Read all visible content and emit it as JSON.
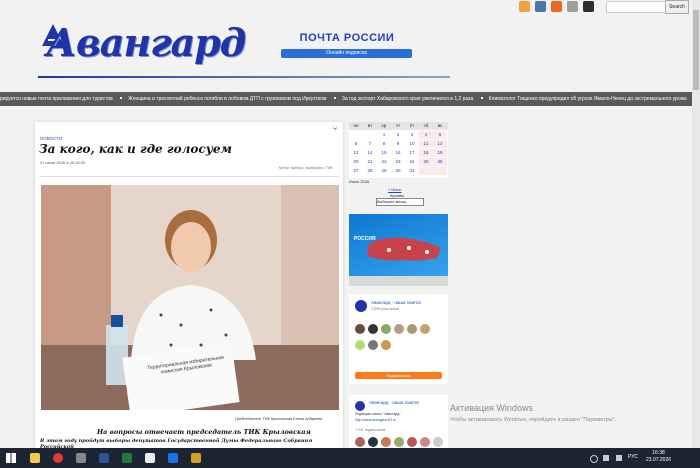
{
  "header": {
    "logo_text": "Авангард",
    "post_title": "ПОЧТА РОССИИ",
    "post_button": "Онлайн подписка",
    "search_button": "Search"
  },
  "ticker": [
    "рируется новые почта приложения для туристов",
    "Женщина и трехлетний ребенок погибли в лобовом ДТП с грузовиком под Иркутском",
    "За год экспорт Хабаровского края увеличился в 1,2 раза",
    "Климатолог Тищенко предупредил об угрозе Ямало-Ненец до экстремального урожа"
  ],
  "article": {
    "rubric": "НОВОСТИ",
    "title": "За кого, как и где голосуем",
    "date": "21 июля 2026 в 20:18:33",
    "tags": "Метки: выборы | выбираем | ТИК",
    "photo_sign": "Территориальная избирательная комиссия Крыловская",
    "caption": "Председатель ТИК Крыловская Елена Андреева",
    "lead": "На вопросы отвечает председатель ТИК Крыловская",
    "body_line": "В этом году пройдут выборы депутатов Государственной Думы Федерального Собрания Российской"
  },
  "calendar": {
    "days": [
      "пн",
      "вт",
      "ср",
      "чт",
      "пт",
      "сб",
      "вс"
    ],
    "rows": [
      [
        "",
        "",
        "1",
        "2",
        "3",
        "4",
        "5"
      ],
      [
        "6",
        "7",
        "8",
        "9",
        "10",
        "11",
        "12"
      ],
      [
        "13",
        "14",
        "15",
        "16",
        "17",
        "18",
        "19"
      ],
      [
        "20",
        "21",
        "22",
        "23",
        "24",
        "25",
        "26"
      ],
      [
        "27",
        "28",
        "29",
        "30",
        "31",
        "",
        ""
      ]
    ],
    "month_label": "Июль 2026",
    "prev_link": "« Июнь",
    "archive_label": "Архивы",
    "archive_select": "Выберите месяц"
  },
  "banner": {
    "text": "РОССИЯ"
  },
  "vk": {
    "group_name": "Авангард - наша газета!",
    "members": "2 895 участников",
    "subscribe": "Подписаться",
    "group_name2": "Авангард - наша газета!",
    "admin_text": "Редакция газеты \"Авангард\"",
    "site": "http://www.avangard-63.ru",
    "count2": "7 241 подписчиков"
  },
  "windows": {
    "activate_title": "Активация Windows",
    "activate_text": "Чтобы активировать Windows, перейдите в раздел \"Параметры\".",
    "lang": "РУС",
    "time": "16:38",
    "date": "23.07.2026"
  },
  "colors": {
    "brand": "#1f34a8",
    "post_button": "#2a6fd6",
    "taskbar": "#1c2533",
    "ticker": "#5a5a5a"
  }
}
